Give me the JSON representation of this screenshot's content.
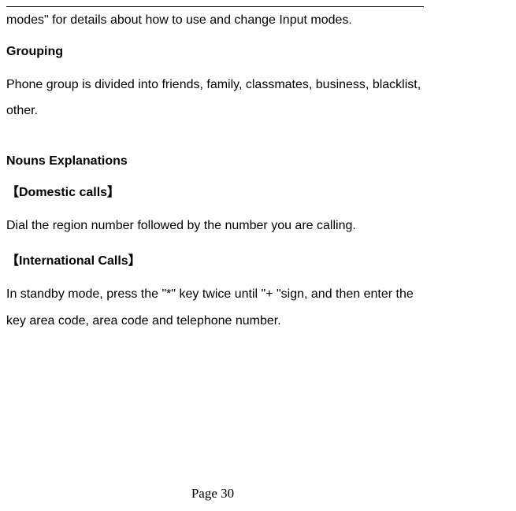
{
  "continuation_text": "modes\" for details about how to use and change Input modes.",
  "grouping": {
    "heading": "Grouping",
    "body": "Phone group is divided into friends, family, classmates, business, blacklist, other."
  },
  "nouns": {
    "heading": "Nouns Explanations",
    "domestic": {
      "label": "【Domestic calls】",
      "body": "Dial the region number followed by the number you are calling."
    },
    "international": {
      "label": "【International Calls】",
      "body": "In standby mode, press the \"*\" key twice until \"+ \"sign, and then enter the key area code, area code and telephone number."
    }
  },
  "page_number": "Page 30"
}
